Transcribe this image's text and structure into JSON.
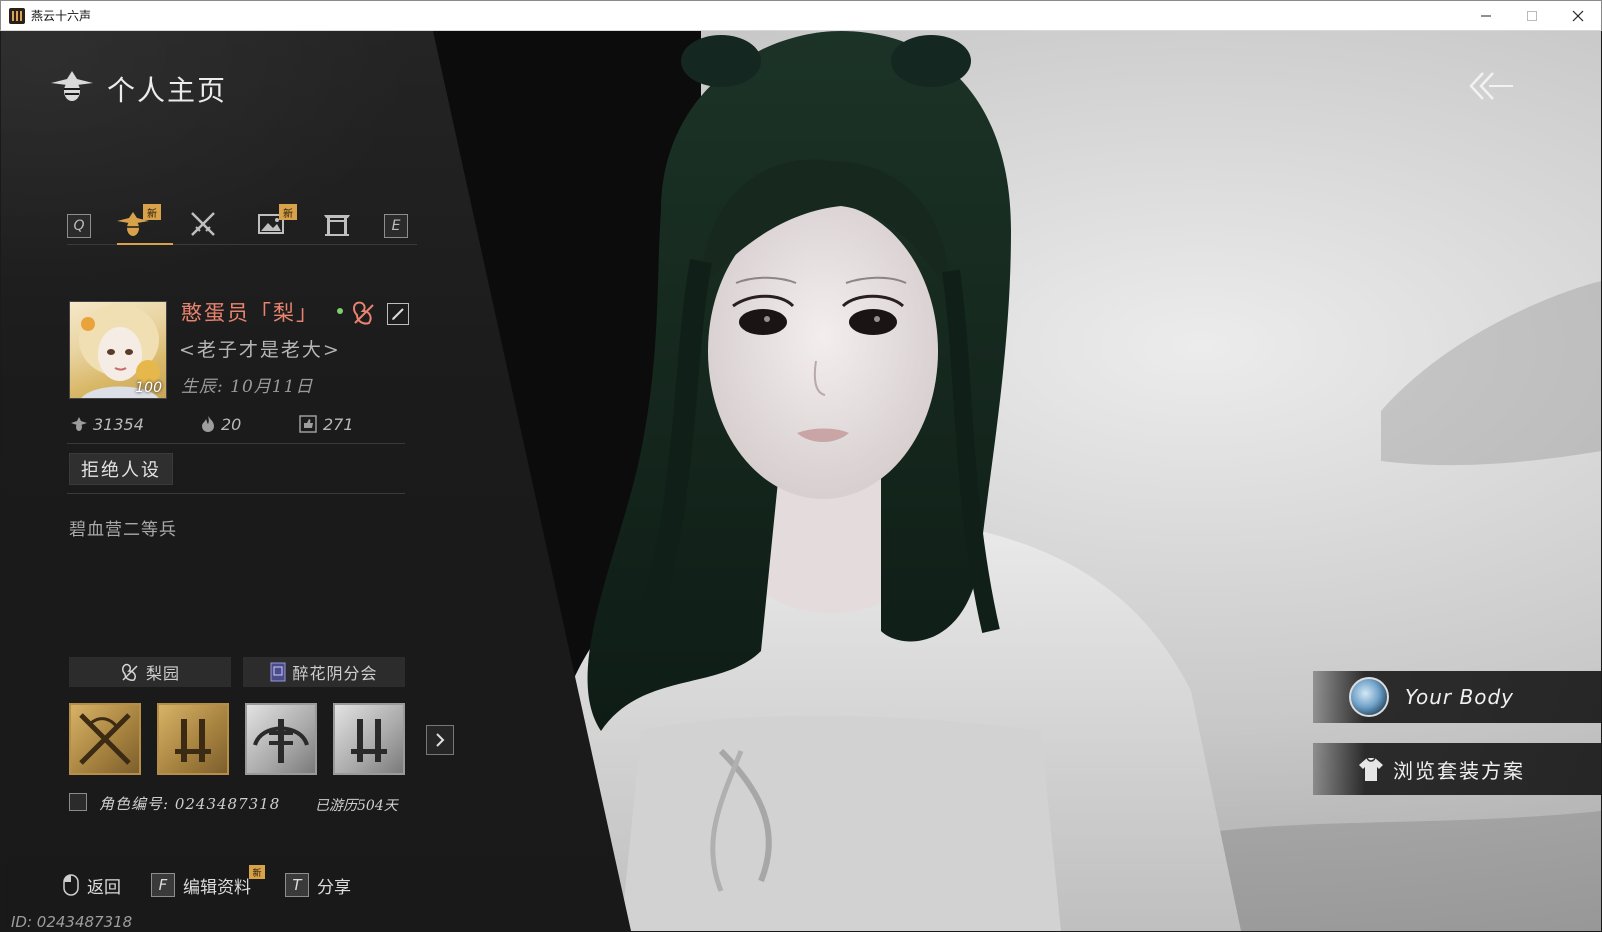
{
  "window": {
    "title": "燕云十六声",
    "controls": [
      "minimize",
      "maximize",
      "close"
    ]
  },
  "header": {
    "title": "个人主页",
    "back_icon": "double-chevron-left-icon"
  },
  "tabs": {
    "left_key": "Q",
    "right_key": "E",
    "items": [
      {
        "icon": "profile-emblem-icon",
        "badge": "新",
        "active": true
      },
      {
        "icon": "crossed-swords-icon",
        "badge": "",
        "active": false
      },
      {
        "icon": "landscape-photo-icon",
        "badge": "新",
        "active": false
      },
      {
        "icon": "gate-icon",
        "badge": "",
        "active": false
      }
    ]
  },
  "profile": {
    "name": "憨蛋员「梨」",
    "name_separator": "•",
    "signature": "<老子才是老大>",
    "birthday": "生辰: 10月11日",
    "level": "100",
    "stats": [
      {
        "icon": "emblem-icon",
        "value": "31354"
      },
      {
        "icon": "flame-icon",
        "value": "20"
      },
      {
        "icon": "thumbs-up-icon",
        "value": "271"
      }
    ],
    "tag": "拒绝人设",
    "bio": "碧血营二等兵"
  },
  "guilds": [
    {
      "icon": "pear-garden-icon",
      "label": "梨园"
    },
    {
      "icon": "banner-icon",
      "label": "醉花阴分会"
    }
  ],
  "badges": [
    {
      "icon": "crossed-weapons-badge-icon",
      "style": "gold"
    },
    {
      "icon": "twin-daggers-badge-icon",
      "style": "gold"
    },
    {
      "icon": "shen-character-badge-icon",
      "style": "silver"
    },
    {
      "icon": "twin-daggers-badge-icon",
      "style": "silver"
    }
  ],
  "character": {
    "id_label": "角色编号: 0243487318",
    "days_label": "已游历504天"
  },
  "actions": [
    {
      "key": "mouse-icon",
      "label": "返回"
    },
    {
      "key": "F",
      "label": "编辑资料",
      "badge": "新"
    },
    {
      "key": "T",
      "label": "分享"
    }
  ],
  "footer": {
    "id_text": "ID: 0243487318"
  },
  "side_buttons": [
    {
      "label": "Your Body",
      "icon": "body-avatar-icon"
    },
    {
      "label": "浏览套装方案",
      "icon": "outfit-icon"
    }
  ],
  "colors": {
    "accent_gold": "#d7a24a",
    "name_color": "#e8836f",
    "online_dot": "#7fcf6a"
  }
}
